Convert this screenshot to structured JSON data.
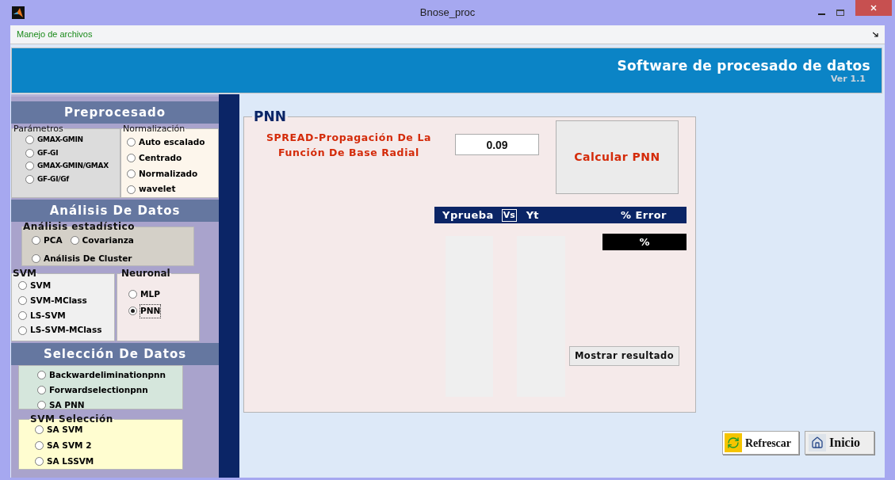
{
  "window": {
    "title": "Bnose_proc"
  },
  "menu": [
    "Manejo de archivos"
  ],
  "banner": {
    "title": "Software de procesado de datos",
    "version": "Ver 1.1"
  },
  "sidebar": {
    "sections": [
      {
        "title": "Preprocesado",
        "groups": [
          {
            "legend": "Parámetros",
            "options": [
              {
                "label": "GMAX-GMIN",
                "selected": false
              },
              {
                "label": "GF-GI",
                "selected": false
              },
              {
                "label": "GMAX-GMIN/GMAX",
                "selected": false
              },
              {
                "label": "GF-GI/Gf",
                "selected": false
              }
            ]
          },
          {
            "legend": "Normalización",
            "options": [
              {
                "label": "Auto escalado",
                "selected": false
              },
              {
                "label": "Centrado",
                "selected": false
              },
              {
                "label": "Normalizado",
                "selected": false
              },
              {
                "label": "wavelet",
                "selected": false
              }
            ]
          }
        ]
      },
      {
        "title": "Análisis De Datos",
        "groups": [
          {
            "legend": "Análisis estadístico",
            "options": [
              {
                "label": "PCA",
                "selected": false
              },
              {
                "label": "Covarianza",
                "selected": false
              },
              {
                "label": "Análisis De Cluster",
                "selected": false
              }
            ]
          },
          {
            "legend": "SVM",
            "options": [
              {
                "label": "SVM",
                "selected": false
              },
              {
                "label": "SVM-MClass",
                "selected": false
              },
              {
                "label": "LS-SVM",
                "selected": false
              },
              {
                "label": "LS-SVM-MClass",
                "selected": false
              }
            ]
          },
          {
            "legend": "Neuronal",
            "options": [
              {
                "label": "MLP",
                "selected": false
              },
              {
                "label": "PNN",
                "selected": true
              }
            ]
          }
        ]
      },
      {
        "title": "Selección De Datos",
        "groups": [
          {
            "options": [
              {
                "label": "Backwardeliminationpnn",
                "selected": false
              },
              {
                "label": "Forwardselectionpnn",
                "selected": false
              },
              {
                "label": "SA PNN",
                "selected": false
              }
            ]
          },
          {
            "legend": "SVM Selección",
            "options": [
              {
                "label": "SA SVM",
                "selected": false
              },
              {
                "label": "SA SVM 2",
                "selected": false
              },
              {
                "label": "SA LSSVM",
                "selected": false
              }
            ]
          }
        ]
      }
    ]
  },
  "panel": {
    "legend": "PNN",
    "spread_label": "SPREAD-Propagación De La Función De Base Radial",
    "spread_value": "0.09",
    "calc_button": "Calcular PNN",
    "results_header": {
      "column_1": "Yprueba",
      "vs": "Vs",
      "column_2": "Yt",
      "error": "% Error"
    },
    "error_value": "%",
    "show_button": "Mostrar resultado"
  },
  "buttons": [
    {
      "label": "Refrescar",
      "kind": "refresh"
    },
    {
      "label": "Inicio",
      "kind": "home"
    }
  ]
}
